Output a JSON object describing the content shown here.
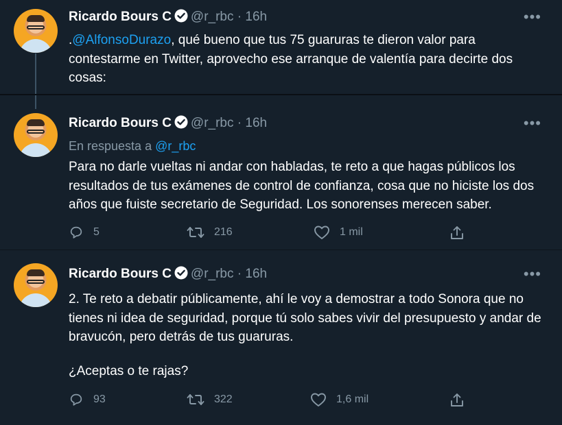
{
  "tweets": [
    {
      "author": "Ricardo Bours C",
      "handle": "@r_rbc",
      "time": "· 16h",
      "mention": "@AlfonsoDurazo",
      "text_prefix": ".",
      "text_rest": ", qué bueno que tus 75 guaruras te dieron valor para contestarme en Twitter, aprovecho ese arranque de valentía para decirte dos cosas:"
    },
    {
      "author": "Ricardo Bours C",
      "handle": "@r_rbc",
      "time": "· 16h",
      "reply_label": "En respuesta a",
      "reply_handle": "@r_rbc",
      "text": "Para no darle vueltas ni andar con habladas, te reto a que hagas públicos los resultados de tus exámenes de control de confianza, cosa que no hiciste los dos años que fuiste secretario de Seguridad. Los sonorenses merecen saber.",
      "replies": "5",
      "retweets": "216",
      "likes": "1 mil"
    },
    {
      "author": "Ricardo Bours C",
      "handle": "@r_rbc",
      "time": "· 16h",
      "text": "2. Te reto a debatir públicamente, ahí le voy a demostrar a todo Sonora que no tienes ni idea de seguridad, porque tú solo sabes vivir del presupuesto y andar de bravucón, pero detrás de tus guaruras.",
      "text2": "¿Aceptas o te rajas?",
      "replies": "93",
      "retweets": "322",
      "likes": "1,6 mil"
    }
  ],
  "more_glyph": "•••",
  "icons": {
    "verified": "verified-badge-icon",
    "reply": "reply-icon",
    "retweet": "retweet-icon",
    "like": "heart-icon",
    "share": "share-icon"
  },
  "colors": {
    "background": "#15202b",
    "link": "#1da1f2",
    "muted": "#8899a6"
  }
}
